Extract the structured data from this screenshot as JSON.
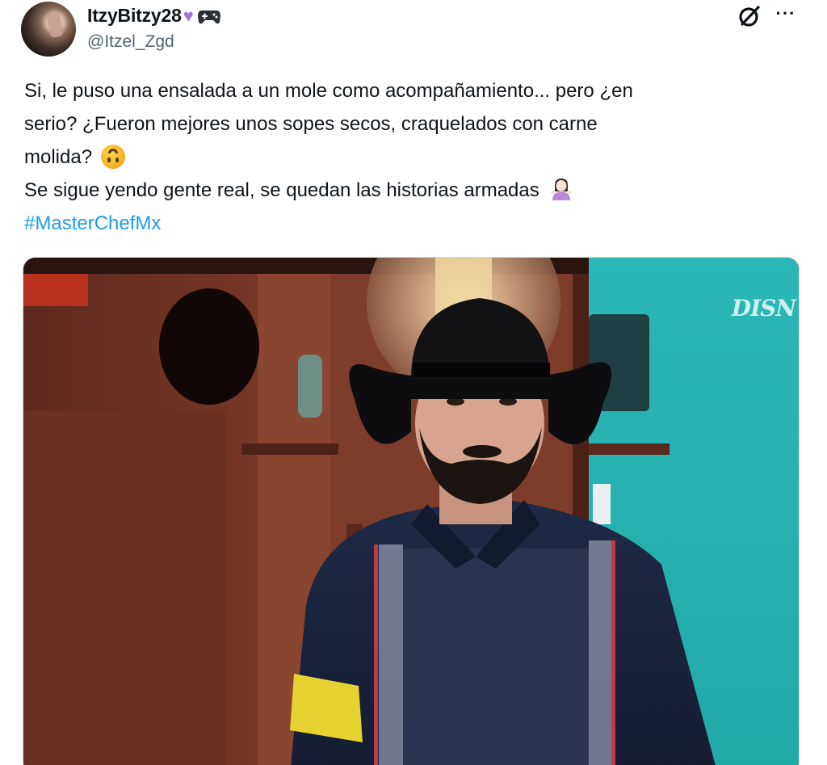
{
  "author": {
    "display_name": "ItzyBitzy28",
    "emoji": [
      "purple-heart",
      "game-controller"
    ],
    "handle": "@Itzel_Zgd"
  },
  "header_icons": [
    "grok-icon",
    "more-icon"
  ],
  "more_label": "···",
  "tweet": {
    "line1": "Si, le puso una ensalada a un mole como acompañamiento... pero ¿en",
    "line2": "serio? ¿Fueron mejores unos sopes secos, craquelados con carne",
    "line3": "molida?",
    "line3_emoji": "upside-down-face",
    "line4": "Se sigue yendo gente real, se quedan las historias armadas",
    "line4_emoji": "woman-shrugging",
    "hashtag": "#MasterChefMx"
  },
  "media": {
    "watermark": "DISN"
  },
  "colors": {
    "link": "#1d9bf0",
    "handle": "#536471",
    "text": "#0f1419"
  }
}
